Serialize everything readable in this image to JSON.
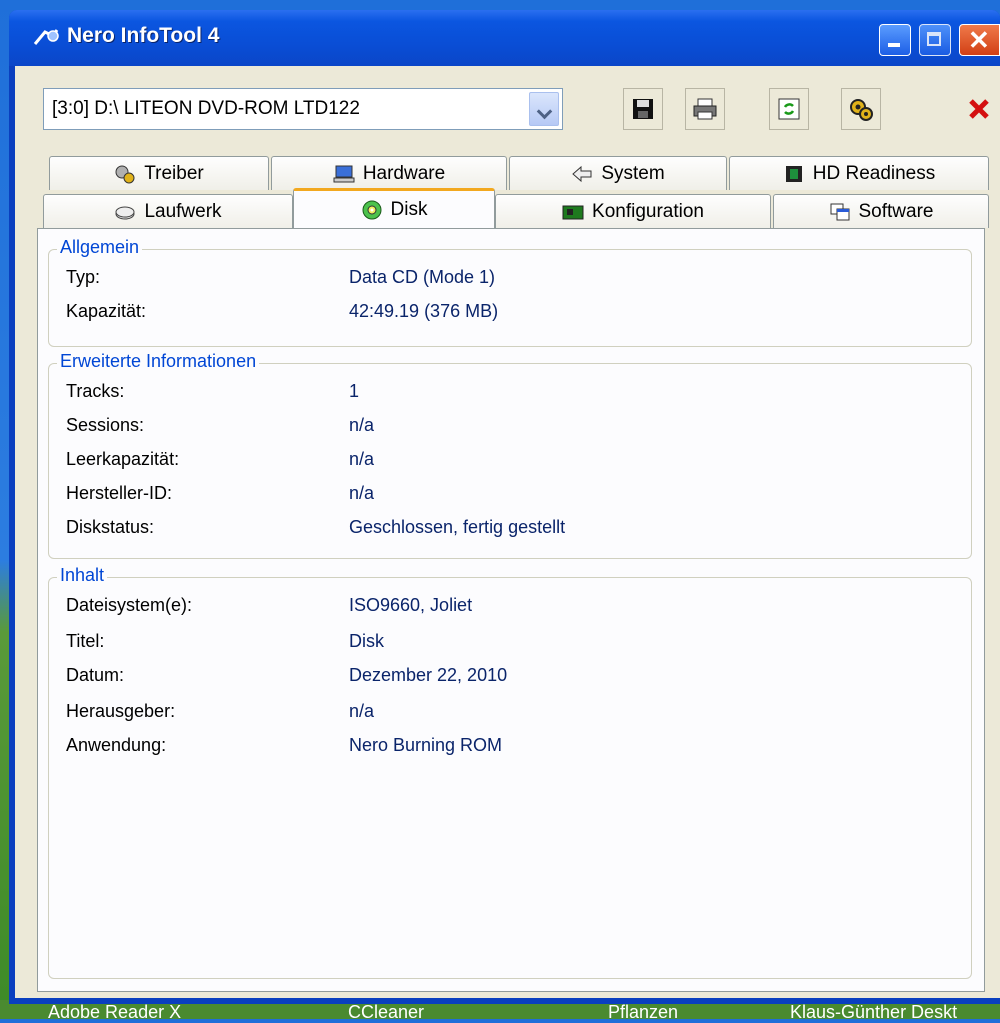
{
  "window": {
    "title": "Nero InfoTool 4"
  },
  "toolbar": {
    "drive_selected": "[3:0] D:\\ LITEON   DVD-ROM LTD122"
  },
  "tabs": {
    "row1": [
      "Treiber",
      "Hardware",
      "System",
      "HD Readiness"
    ],
    "row2": [
      "Laufwerk",
      "Disk",
      "Konfiguration",
      "Software"
    ],
    "active": "Disk"
  },
  "groups": {
    "allgemein": {
      "title": "Allgemein",
      "rows": [
        {
          "label": "Typ:",
          "value": "Data CD (Mode 1)"
        },
        {
          "label": "Kapazität:",
          "value": "42:49.19  (376 MB)"
        }
      ]
    },
    "erweitert": {
      "title": "Erweiterte Informationen",
      "rows": [
        {
          "label": "Tracks:",
          "value": "1"
        },
        {
          "label": "Sessions:",
          "value": "n/a"
        },
        {
          "label": "Leerkapazität:",
          "value": "n/a"
        },
        {
          "label": "Hersteller-ID:",
          "value": "n/a"
        },
        {
          "label": "Diskstatus:",
          "value": "Geschlossen, fertig gestellt"
        }
      ]
    },
    "inhalt": {
      "title": "Inhalt",
      "rows": [
        {
          "label": "Dateisystem(e):",
          "value": "ISO9660, Joliet"
        },
        {
          "label": "Titel:",
          "value": "Disk"
        },
        {
          "label": "Datum:",
          "value": "Dezember 22, 2010"
        },
        {
          "label": "Herausgeber:",
          "value": "n/a"
        },
        {
          "label": "Anwendung:",
          "value": "Nero Burning ROM"
        }
      ]
    }
  },
  "desktop_labels": [
    "Adobe Reader X",
    "CCleaner",
    "Pflanzen",
    "Klaus-Günther Deskt"
  ]
}
